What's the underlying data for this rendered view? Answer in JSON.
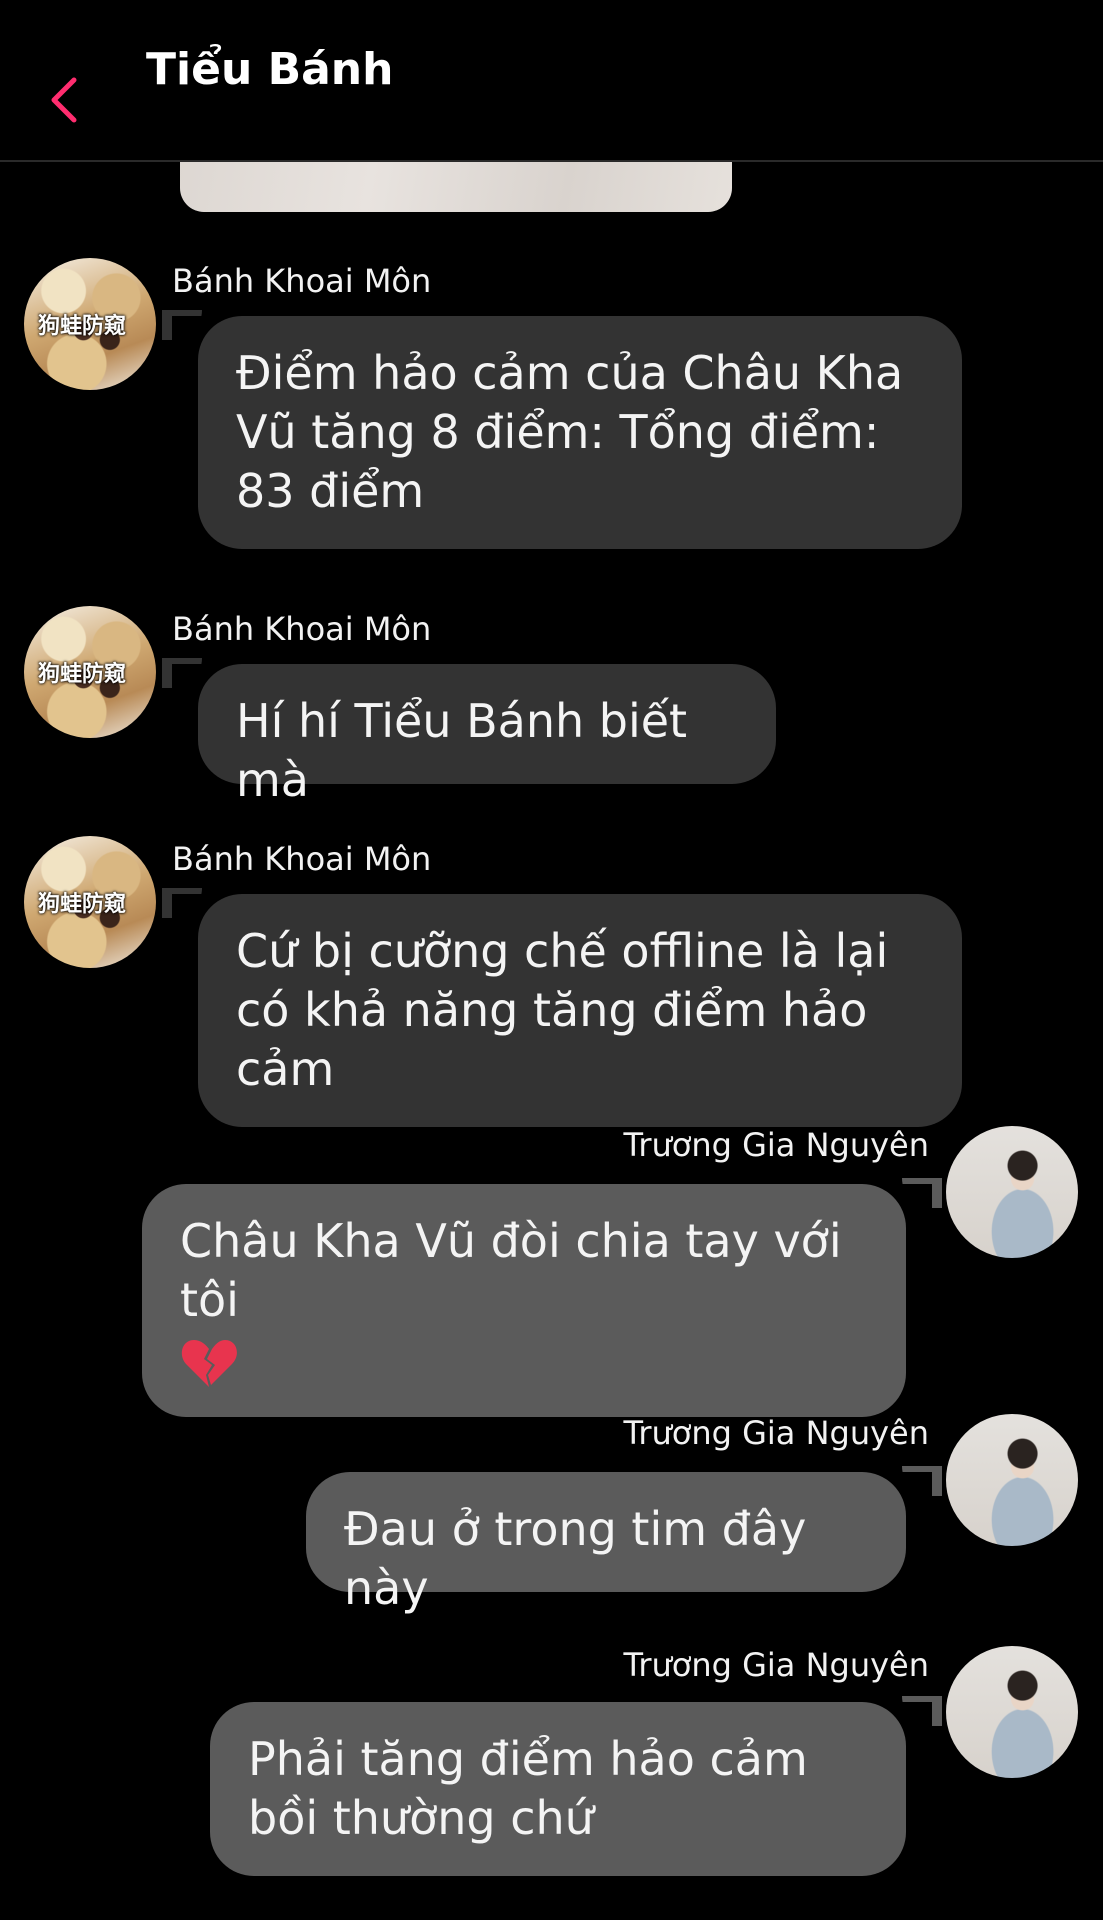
{
  "header": {
    "title": "Tiểu Bánh"
  },
  "messages": [
    {
      "sender": "Bánh Khoai Môn",
      "direction": "incoming",
      "text": "Điểm hảo cảm của Châu Kha Vũ tăng 8 điểm: Tổng điểm: 83 điểm",
      "avatar_seal": "狗蛙防窥"
    },
    {
      "sender": "Bánh Khoai Môn",
      "direction": "incoming",
      "text": "Hí hí Tiểu Bánh biết mà",
      "avatar_seal": "狗蛙防窥"
    },
    {
      "sender": "Bánh Khoai Môn",
      "direction": "incoming",
      "text": "Cứ bị cưỡng chế offline là lại có khả năng tăng điểm hảo cảm",
      "avatar_seal": "狗蛙防窥"
    },
    {
      "sender": "Trương Gia Nguyên",
      "direction": "outgoing",
      "text": "Châu Kha Vũ đòi chia tay với tôi",
      "emoji": "broken-heart-icon"
    },
    {
      "sender": "Trương Gia Nguyên",
      "direction": "outgoing",
      "text": "Đau ở trong tim đây này"
    },
    {
      "sender": "Trương Gia Nguyên",
      "direction": "outgoing",
      "text": "Phải tăng điểm hảo cảm bồi thường chứ"
    }
  ],
  "colors": {
    "background": "#000000",
    "accent": "#ff2d6f",
    "incoming_bubble": "#333333",
    "outgoing_bubble": "#5b5b5b",
    "text": "#ffffff"
  }
}
